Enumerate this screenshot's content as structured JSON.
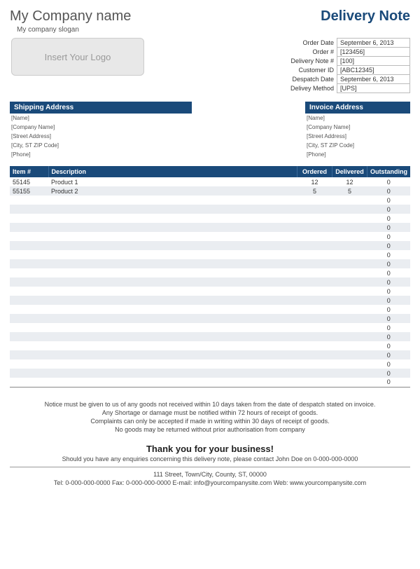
{
  "header": {
    "company_name": "My Company name",
    "company_slogan": "My company slogan",
    "doc_title": "Delivery Note",
    "logo_placeholder": "Insert Your Logo"
  },
  "meta": {
    "labels": {
      "order_date": "Order Date",
      "order_num": "Order #",
      "delivery_note_num": "Delivery Note #",
      "customer_id": "Customer ID",
      "despatch_date": "Despatch Date",
      "delivery_method": "Delivey Method"
    },
    "values": {
      "order_date": "September 6, 2013",
      "order_num": "[123456]",
      "delivery_note_num": "[100]",
      "customer_id": "[ABC12345]",
      "despatch_date": "September 6, 2013",
      "delivery_method": "[UPS]"
    }
  },
  "shipping": {
    "title": "Shipping Address",
    "lines": [
      "[Name]",
      "[Company Name]",
      "[Street Address]",
      "[City, ST  ZIP Code]",
      "[Phone]"
    ]
  },
  "invoice": {
    "title": "Invoice Address",
    "lines": [
      "[Name]",
      "[Company Name]",
      "[Street Address]",
      "[City, ST  ZIP Code]",
      "[Phone]"
    ]
  },
  "items_header": {
    "item": "Item #",
    "desc": "Description",
    "ordered": "Ordered",
    "delivered": "Delivered",
    "outstanding": "Outstanding"
  },
  "items": [
    {
      "item": "55145",
      "desc": "Product 1",
      "ordered": "12",
      "delivered": "12",
      "outstanding": "0"
    },
    {
      "item": "55155",
      "desc": "Product 2",
      "ordered": "5",
      "delivered": "5",
      "outstanding": "0"
    },
    {
      "item": "",
      "desc": "",
      "ordered": "",
      "delivered": "",
      "outstanding": "0"
    },
    {
      "item": "",
      "desc": "",
      "ordered": "",
      "delivered": "",
      "outstanding": "0"
    },
    {
      "item": "",
      "desc": "",
      "ordered": "",
      "delivered": "",
      "outstanding": "0"
    },
    {
      "item": "",
      "desc": "",
      "ordered": "",
      "delivered": "",
      "outstanding": "0"
    },
    {
      "item": "",
      "desc": "",
      "ordered": "",
      "delivered": "",
      "outstanding": "0"
    },
    {
      "item": "",
      "desc": "",
      "ordered": "",
      "delivered": "",
      "outstanding": "0"
    },
    {
      "item": "",
      "desc": "",
      "ordered": "",
      "delivered": "",
      "outstanding": "0"
    },
    {
      "item": "",
      "desc": "",
      "ordered": "",
      "delivered": "",
      "outstanding": "0"
    },
    {
      "item": "",
      "desc": "",
      "ordered": "",
      "delivered": "",
      "outstanding": "0"
    },
    {
      "item": "",
      "desc": "",
      "ordered": "",
      "delivered": "",
      "outstanding": "0"
    },
    {
      "item": "",
      "desc": "",
      "ordered": "",
      "delivered": "",
      "outstanding": "0"
    },
    {
      "item": "",
      "desc": "",
      "ordered": "",
      "delivered": "",
      "outstanding": "0"
    },
    {
      "item": "",
      "desc": "",
      "ordered": "",
      "delivered": "",
      "outstanding": "0"
    },
    {
      "item": "",
      "desc": "",
      "ordered": "",
      "delivered": "",
      "outstanding": "0"
    },
    {
      "item": "",
      "desc": "",
      "ordered": "",
      "delivered": "",
      "outstanding": "0"
    },
    {
      "item": "",
      "desc": "",
      "ordered": "",
      "delivered": "",
      "outstanding": "0"
    },
    {
      "item": "",
      "desc": "",
      "ordered": "",
      "delivered": "",
      "outstanding": "0"
    },
    {
      "item": "",
      "desc": "",
      "ordered": "",
      "delivered": "",
      "outstanding": "0"
    },
    {
      "item": "",
      "desc": "",
      "ordered": "",
      "delivered": "",
      "outstanding": "0"
    },
    {
      "item": "",
      "desc": "",
      "ordered": "",
      "delivered": "",
      "outstanding": "0"
    },
    {
      "item": "",
      "desc": "",
      "ordered": "",
      "delivered": "",
      "outstanding": "0"
    }
  ],
  "notice": {
    "l1": "Notice must be given to us of any goods not received within 10 days taken from the date of despatch stated on invoice.",
    "l2": "Any Shortage or damage must be notified within 72 hours of receipt of goods.",
    "l3": "Complaints can only be accepted if made in writing within 30 days of receipt of goods.",
    "l4": "No goods may be returned without prior authorisation from company"
  },
  "thanks": {
    "title": "Thank you for your business!",
    "sub": "Should you have any enquiries concerning this delivery note, please contact John Doe on 0-000-000-0000"
  },
  "footer": {
    "l1": "111 Street, Town/City, County, ST, 00000",
    "l2": "Tel: 0-000-000-0000 Fax: 0-000-000-0000 E-mail: info@yourcompanysite.com Web: www.yourcompanysite.com"
  }
}
